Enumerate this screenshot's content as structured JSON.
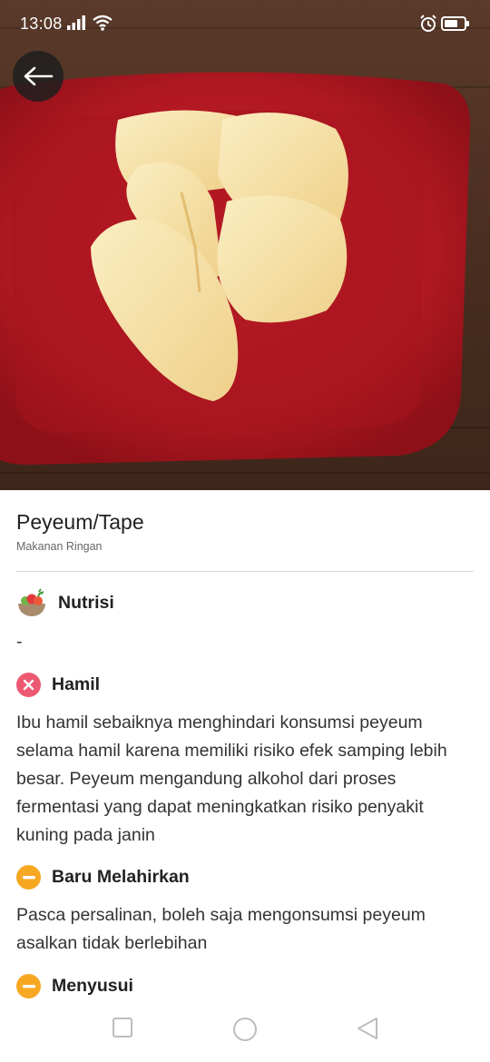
{
  "status_bar": {
    "time": "13:08",
    "signal_icon": "signal-icon",
    "wifi_icon": "wifi-icon",
    "alarm_icon": "alarm-icon",
    "battery_icon": "battery-icon"
  },
  "header": {
    "back_icon": "arrow-left-icon"
  },
  "food": {
    "title": "Peyeum/Tape",
    "category": "Makanan Ringan"
  },
  "sections": [
    {
      "label": "Nutrisi",
      "icon": "food-basket-icon",
      "text": "-"
    },
    {
      "label": "Hamil",
      "icon": "x-circle-icon",
      "status_color": "#ec5a72",
      "text": "Ibu hamil sebaiknya menghindari konsumsi peyeum selama hamil karena memiliki risiko efek samping lebih besar. Peyeum mengandung alkohol dari proses fermentasi yang dapat meningkatkan risiko penyakit kuning pada janin"
    },
    {
      "label": "Baru Melahirkan",
      "icon": "minus-circle-icon",
      "status_color": "#f7a823",
      "text": "Pasca persalinan, boleh saja mengonsumsi peyeum asalkan tidak berlebihan"
    },
    {
      "label": "Menyusui",
      "icon": "minus-circle-icon",
      "status_color": "#f7a823"
    }
  ],
  "nav_bar": {
    "recent_icon": "square-icon",
    "home_icon": "circle-icon",
    "back_icon": "triangle-back-icon"
  }
}
